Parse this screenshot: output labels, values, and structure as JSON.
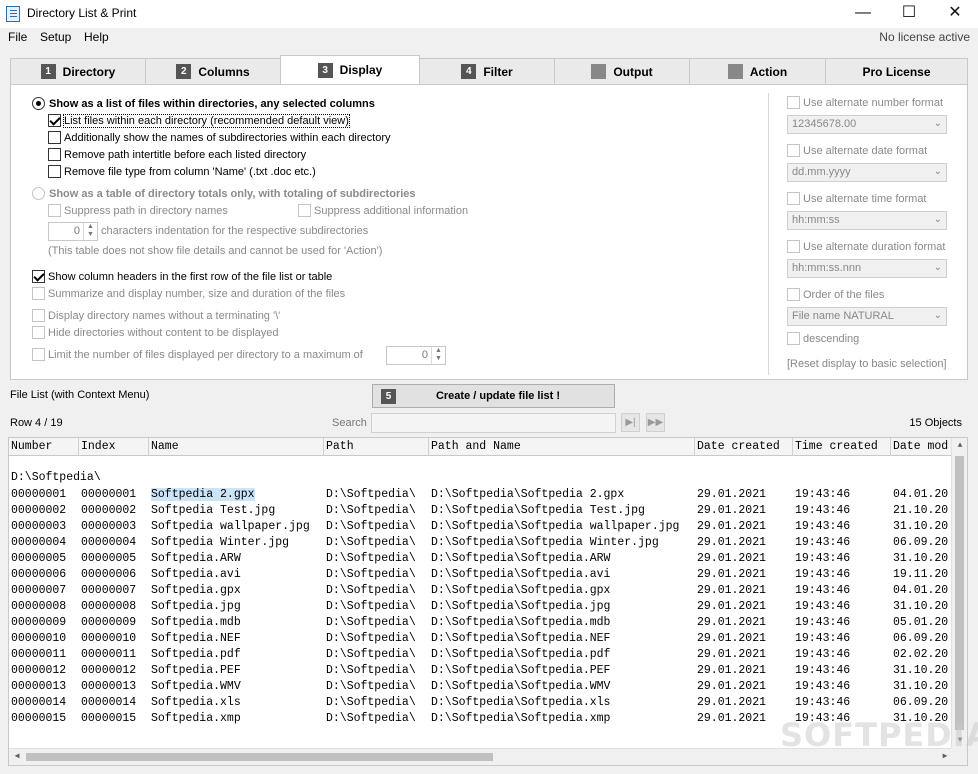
{
  "window": {
    "title": "Directory List & Print"
  },
  "menu": {
    "items": [
      "File",
      "Setup",
      "Help"
    ],
    "license_status": "No license active"
  },
  "tabs": [
    {
      "num": "1",
      "label": "Directory",
      "active": false
    },
    {
      "num": "2",
      "label": "Columns",
      "active": false
    },
    {
      "num": "3",
      "label": "Display",
      "active": true
    },
    {
      "num": "4",
      "label": "Filter",
      "active": false
    },
    {
      "num": "",
      "label": "Output",
      "active": false,
      "icon": "document-icon"
    },
    {
      "num": "",
      "label": "Action",
      "active": false,
      "icon": "gear-icon"
    },
    {
      "num": "",
      "label": "Pro License",
      "active": false
    }
  ],
  "display": {
    "opt_list_mode": "Show as a list of files within directories, any selected columns",
    "opt_list_files": "List files within each directory (recommended default view)",
    "opt_show_subdirs": "Additionally show the names of subdirectories within each directory",
    "opt_remove_intertitle": "Remove path intertitle before each listed directory",
    "opt_remove_filetype": "Remove file type from column 'Name' (.txt .doc etc.)",
    "opt_table_mode": "Show as a table of directory totals only, with totaling of subdirectories",
    "opt_suppress_path": "Suppress path in directory names",
    "opt_suppress_info": "Suppress additional information",
    "indent_value": "0",
    "indent_label": "characters indentation for the respective subdirectories",
    "table_note": "(This table does not show file details and cannot be used for 'Action')",
    "opt_column_headers": "Show column headers in the first row of the file list or table",
    "opt_summarize": "Summarize and display number, size and duration of the files",
    "opt_no_terminating": "Display directory names without a terminating '\\'",
    "opt_hide_empty": "Hide directories without content to be displayed",
    "opt_limit_files": "Limit the number of files displayed per directory to a maximum of",
    "limit_value": "0"
  },
  "format": {
    "alt_number_label": "Use alternate number format",
    "alt_number_value": "12345678.00",
    "alt_date_label": "Use alternate date format",
    "alt_date_value": "dd.mm.yyyy",
    "alt_time_label": "Use alternate time format",
    "alt_time_value": "hh:mm:ss",
    "alt_duration_label": "Use alternate duration format",
    "alt_duration_value": "hh:mm:ss.nnn",
    "order_label": "Order of the files",
    "order_value": "File name NATURAL",
    "descending_label": "descending",
    "reset_label": "[Reset display to basic selection]"
  },
  "filelist": {
    "label": "File List (with Context Menu)",
    "create_num": "5",
    "create_label": "Create / update file list !",
    "row_info": "Row 4 / 19",
    "search_label": "Search",
    "object_count": "15 Objects",
    "columns": [
      "Number",
      "Index",
      "Name",
      "Path",
      "Path and Name",
      "Date created",
      "Time created",
      "Date mod"
    ],
    "directory": "D:\\Softpedia\\",
    "rows": [
      [
        "00000001",
        "00000001",
        "Softpedia 2.gpx",
        "D:\\Softpedia\\",
        "D:\\Softpedia\\Softpedia 2.gpx",
        "29.01.2021",
        "19:43:46",
        "04.01.20"
      ],
      [
        "00000002",
        "00000002",
        "Softpedia Test.jpg",
        "D:\\Softpedia\\",
        "D:\\Softpedia\\Softpedia Test.jpg",
        "29.01.2021",
        "19:43:46",
        "21.10.20"
      ],
      [
        "00000003",
        "00000003",
        "Softpedia wallpaper.jpg",
        "D:\\Softpedia\\",
        "D:\\Softpedia\\Softpedia wallpaper.jpg",
        "29.01.2021",
        "19:43:46",
        "31.10.20"
      ],
      [
        "00000004",
        "00000004",
        "Softpedia Winter.jpg",
        "D:\\Softpedia\\",
        "D:\\Softpedia\\Softpedia Winter.jpg",
        "29.01.2021",
        "19:43:46",
        "06.09.20"
      ],
      [
        "00000005",
        "00000005",
        "Softpedia.ARW",
        "D:\\Softpedia\\",
        "D:\\Softpedia\\Softpedia.ARW",
        "29.01.2021",
        "19:43:46",
        "31.10.20"
      ],
      [
        "00000006",
        "00000006",
        "Softpedia.avi",
        "D:\\Softpedia\\",
        "D:\\Softpedia\\Softpedia.avi",
        "29.01.2021",
        "19:43:46",
        "19.11.20"
      ],
      [
        "00000007",
        "00000007",
        "Softpedia.gpx",
        "D:\\Softpedia\\",
        "D:\\Softpedia\\Softpedia.gpx",
        "29.01.2021",
        "19:43:46",
        "04.01.20"
      ],
      [
        "00000008",
        "00000008",
        "Softpedia.jpg",
        "D:\\Softpedia\\",
        "D:\\Softpedia\\Softpedia.jpg",
        "29.01.2021",
        "19:43:46",
        "31.10.20"
      ],
      [
        "00000009",
        "00000009",
        "Softpedia.mdb",
        "D:\\Softpedia\\",
        "D:\\Softpedia\\Softpedia.mdb",
        "29.01.2021",
        "19:43:46",
        "05.01.20"
      ],
      [
        "00000010",
        "00000010",
        "Softpedia.NEF",
        "D:\\Softpedia\\",
        "D:\\Softpedia\\Softpedia.NEF",
        "29.01.2021",
        "19:43:46",
        "06.09.20"
      ],
      [
        "00000011",
        "00000011",
        "Softpedia.pdf",
        "D:\\Softpedia\\",
        "D:\\Softpedia\\Softpedia.pdf",
        "29.01.2021",
        "19:43:46",
        "02.02.20"
      ],
      [
        "00000012",
        "00000012",
        "Softpedia.PEF",
        "D:\\Softpedia\\",
        "D:\\Softpedia\\Softpedia.PEF",
        "29.01.2021",
        "19:43:46",
        "31.10.20"
      ],
      [
        "00000013",
        "00000013",
        "Softpedia.WMV",
        "D:\\Softpedia\\",
        "D:\\Softpedia\\Softpedia.WMV",
        "29.01.2021",
        "19:43:46",
        "31.10.20"
      ],
      [
        "00000014",
        "00000014",
        "Softpedia.xls",
        "D:\\Softpedia\\",
        "D:\\Softpedia\\Softpedia.xls",
        "29.01.2021",
        "19:43:46",
        "06.09.20"
      ],
      [
        "00000015",
        "00000015",
        "Softpedia.xmp",
        "D:\\Softpedia\\",
        "D:\\Softpedia\\Softpedia.xmp",
        "29.01.2021",
        "19:43:46",
        "31.10.20"
      ]
    ]
  },
  "watermark": "SOFTPEDIA"
}
